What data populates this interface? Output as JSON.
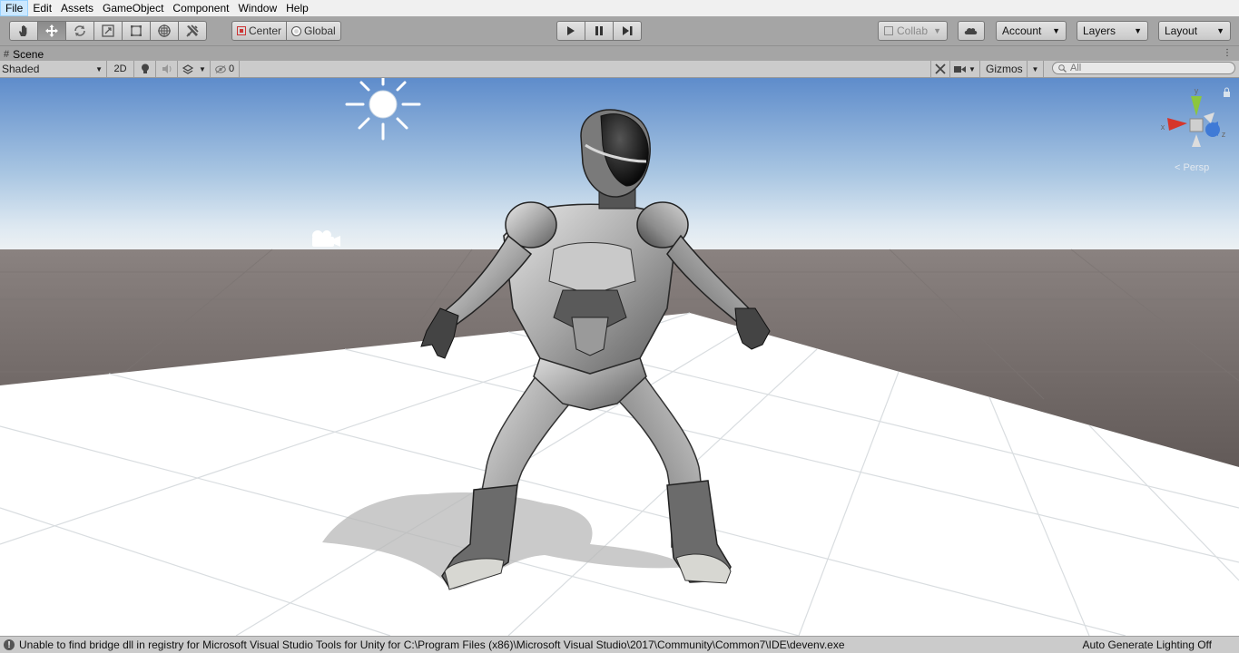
{
  "menu": {
    "items": [
      "File",
      "Edit",
      "Assets",
      "GameObject",
      "Component",
      "Window",
      "Help"
    ],
    "active": "File"
  },
  "toolbar": {
    "tools": [
      {
        "name": "hand-tool",
        "icon": "hand-icon"
      },
      {
        "name": "move-tool",
        "icon": "move-arrows-icon",
        "active": true
      },
      {
        "name": "rotate-tool",
        "icon": "rotate-icon"
      },
      {
        "name": "scale-tool",
        "icon": "scale-icon"
      },
      {
        "name": "rect-tool",
        "icon": "rect-icon"
      },
      {
        "name": "transform-tool",
        "icon": "transform-icon"
      },
      {
        "name": "custom-tool",
        "icon": "tools-icon"
      }
    ],
    "pivot_label": "Center",
    "rotation_label": "Global",
    "collab_label": "Collab",
    "account_label": "Account",
    "layers_label": "Layers",
    "layout_label": "Layout"
  },
  "scene_tab": {
    "label": "Scene"
  },
  "scene_toolbar": {
    "draw_mode": "Shaded",
    "toggle_2d": "2D",
    "hidden_count": "0",
    "gizmos_label": "Gizmos",
    "search_placeholder": "All"
  },
  "scene_view": {
    "axis_labels": {
      "y": "y",
      "x": "x",
      "z": "z"
    },
    "persp_label": "< Persp"
  },
  "status": {
    "message": "Unable to find bridge dll in registry for Microsoft Visual Studio Tools for Unity for C:\\Program Files (x86)\\Microsoft Visual Studio\\2017\\Community\\Common7\\IDE\\devenv.exe",
    "lighting": "Auto Generate Lighting Off"
  },
  "colors": {
    "sky_top": "#5f8fcf",
    "sky_horizon": "#e6edf3",
    "ground": "#6f6866",
    "plane": "#ffffff",
    "toolbar": "#a5a5a5"
  }
}
